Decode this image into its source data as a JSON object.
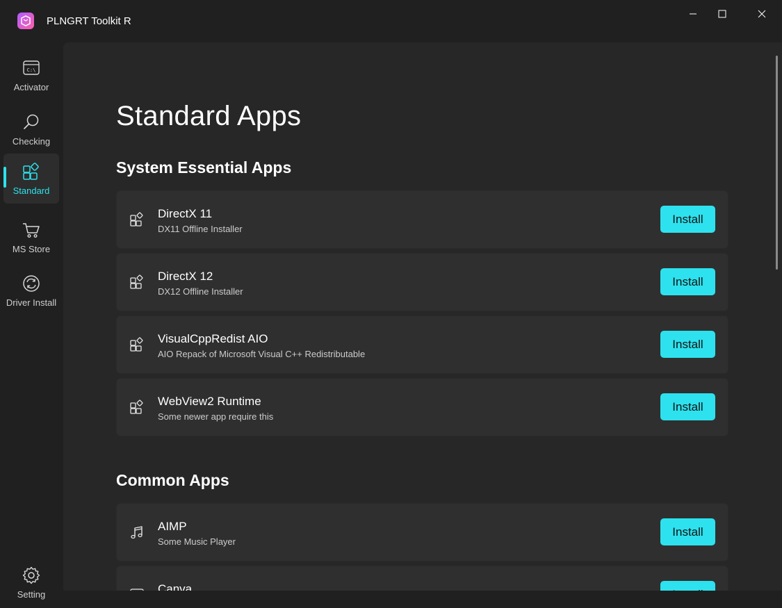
{
  "window": {
    "title": "PLNGRT Toolkit R",
    "minimize_glyph": "—",
    "maximize_glyph": "☐",
    "close_glyph": "✕"
  },
  "sidebar": {
    "items": [
      {
        "label": "Activator",
        "icon": "terminal-icon"
      },
      {
        "label": "Checking",
        "icon": "search-icon"
      },
      {
        "label": "Standard",
        "icon": "apps-icon",
        "active": true
      },
      {
        "label": "MS Store",
        "icon": "cart-icon"
      },
      {
        "label": "Driver Install",
        "icon": "sync-icon"
      }
    ],
    "settings_label": "Setting"
  },
  "main": {
    "page_title": "Standard Apps",
    "sections": [
      {
        "title": "System Essential Apps",
        "apps": [
          {
            "name": "DirectX 11",
            "desc": "DX11 Offline Installer",
            "button": "Install",
            "icon": "apps-icon"
          },
          {
            "name": "DirectX 12",
            "desc": "DX12 Offline Installer",
            "button": "Install",
            "icon": "apps-icon"
          },
          {
            "name": "VisualCppRedist AIO",
            "desc": "AIO Repack of Microsoft Visual C++ Redistributable",
            "button": "Install",
            "icon": "apps-icon"
          },
          {
            "name": "WebView2 Runtime",
            "desc": "Some newer app require this",
            "button": "Install",
            "icon": "apps-icon"
          }
        ]
      },
      {
        "title": "Common Apps",
        "apps": [
          {
            "name": "AIMP",
            "desc": "Some Music Player",
            "button": "Install",
            "icon": "music-note-icon"
          },
          {
            "name": "Canva",
            "desc": "",
            "button": "Install",
            "icon": "app-icon"
          }
        ]
      }
    ]
  },
  "colors": {
    "accent": "#2de2ee",
    "background": "#202020",
    "content": "#272727",
    "card": "#2f2f2f"
  }
}
